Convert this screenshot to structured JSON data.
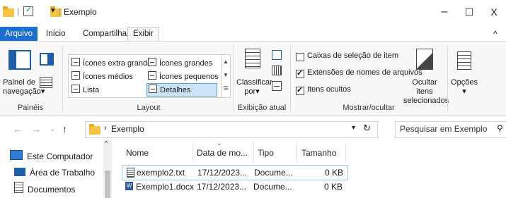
{
  "window": {
    "title": "Exemplo",
    "controls": {
      "minimize": "–",
      "maximize": "☐",
      "close": "X"
    }
  },
  "ribbon": {
    "tabs": [
      "Arquivo",
      "Início",
      "Compartilhar",
      "Exibir"
    ],
    "active_tab": "Exibir",
    "collapse_glyph": "^",
    "panes_group": {
      "label": "Painéis",
      "navigation_pane": [
        "Painel de",
        "navegação"
      ]
    },
    "layout_group": {
      "label": "Layout",
      "items": [
        "Ícones extra grandes",
        "Ícones grandes",
        "Ícones médios",
        "Ícones pequenos",
        "Lista",
        "Detalhes"
      ],
      "selected": "Detalhes"
    },
    "current_view_group": {
      "label": "Exibição atual",
      "sort": [
        "Classificar",
        "por"
      ]
    },
    "show_hide_group": {
      "label": "Mostrar/ocultar",
      "checkboxes": [
        {
          "label": "Caixas de seleção de item",
          "checked": false
        },
        {
          "label": "Extensões de nomes de arquivos",
          "checked": true
        },
        {
          "label": "Itens ocultos",
          "checked": true
        }
      ],
      "hide_selected": [
        "Ocultar itens",
        "selecionados"
      ]
    },
    "options": "Opções"
  },
  "navigation": {
    "breadcrumb": [
      "Exemplo"
    ],
    "search_placeholder": "Pesquisar em Exemplo"
  },
  "nav_pane": {
    "items": [
      "Este Computador",
      "Área de Trabalho",
      "Documentos"
    ]
  },
  "file_list": {
    "columns": [
      "Nome",
      "Data de mo...",
      "Tipo",
      "Tamanho"
    ],
    "rows": [
      {
        "name": "exemplo2.txt",
        "date": "17/12/2023...",
        "type": "Docume...",
        "size": "0 KB",
        "selected": true
      },
      {
        "name": "Exemplo1.docx",
        "date": "17/12/2023...",
        "type": "Docume...",
        "size": "0 KB",
        "selected": false
      }
    ]
  },
  "colors": {
    "file_tab": "#1e6ecf",
    "selection": "#cce4f7",
    "folder": "#f6c343"
  }
}
